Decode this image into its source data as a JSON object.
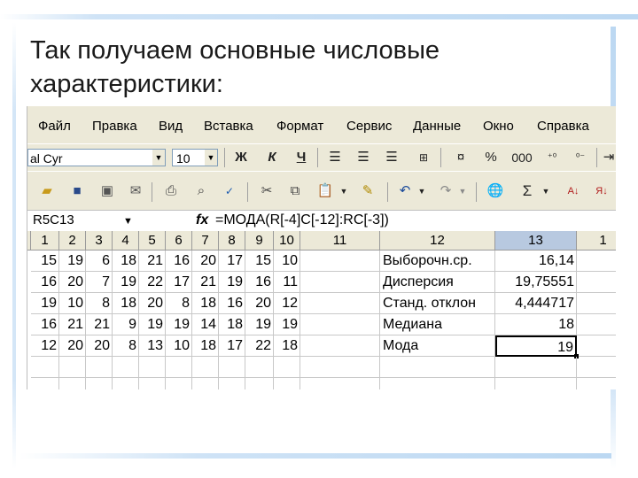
{
  "slide": {
    "title_line1": "Так получаем основные числовые",
    "title_line2": "характеристики:"
  },
  "menu": [
    "Файл",
    "Правка",
    "Вид",
    "Вставка",
    "Формат",
    "Сервис",
    "Данные",
    "Окно",
    "Справка"
  ],
  "format_toolbar": {
    "font_name": "al Cyr",
    "font_size": "10",
    "bold": "Ж",
    "italic": "К",
    "underline": "Ч",
    "percent": "%",
    "thousands": "000"
  },
  "formula_bar": {
    "cell_ref": "R5C13",
    "fx_label": "fx",
    "formula": "=МОДА(R[-4]C[-12]:RC[-3])"
  },
  "grid": {
    "column_headers": [
      "1",
      "2",
      "3",
      "4",
      "5",
      "6",
      "7",
      "8",
      "9",
      "10",
      "11",
      "12",
      "13",
      "1"
    ],
    "rows": [
      {
        "values": [
          "15",
          "19",
          "6",
          "18",
          "21",
          "16",
          "20",
          "17",
          "15",
          "10"
        ],
        "label": "Выборочн.ср.",
        "result": "16,14"
      },
      {
        "values": [
          "16",
          "20",
          "7",
          "19",
          "22",
          "17",
          "21",
          "19",
          "16",
          "11"
        ],
        "label": "Дисперсия",
        "result": "19,75551"
      },
      {
        "values": [
          "19",
          "10",
          "8",
          "18",
          "20",
          "8",
          "18",
          "16",
          "20",
          "12"
        ],
        "label": "Станд. отклон",
        "result": "4,444717"
      },
      {
        "values": [
          "16",
          "21",
          "21",
          "9",
          "19",
          "19",
          "14",
          "18",
          "19",
          "19"
        ],
        "label": "Медиана",
        "result": "18"
      },
      {
        "values": [
          "12",
          "20",
          "20",
          "8",
          "13",
          "10",
          "18",
          "17",
          "22",
          "18"
        ],
        "label": "Мода",
        "result": "19"
      }
    ]
  },
  "colors": {
    "excel_chrome": "#ece9d8",
    "selected_header": "#b8c9e0",
    "slide_accent": "#bcd8f2"
  }
}
